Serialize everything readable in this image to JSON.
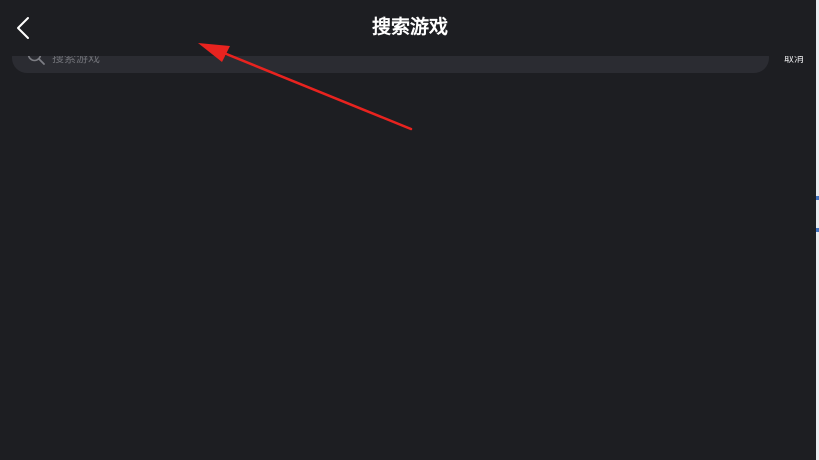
{
  "header": {
    "title": "搜索游戏",
    "back_icon": "chevron-left-icon"
  },
  "search": {
    "placeholder": "搜索游戏",
    "value": "",
    "icon": "search-icon",
    "cancel_label": "取消"
  },
  "colors": {
    "background": "#1d1e22",
    "search_field": "#2b2c32",
    "title_text": "#ffffff",
    "annotation_arrow": "#e8231f"
  },
  "annotation": {
    "type": "red-arrow",
    "points_to": "search-input"
  }
}
